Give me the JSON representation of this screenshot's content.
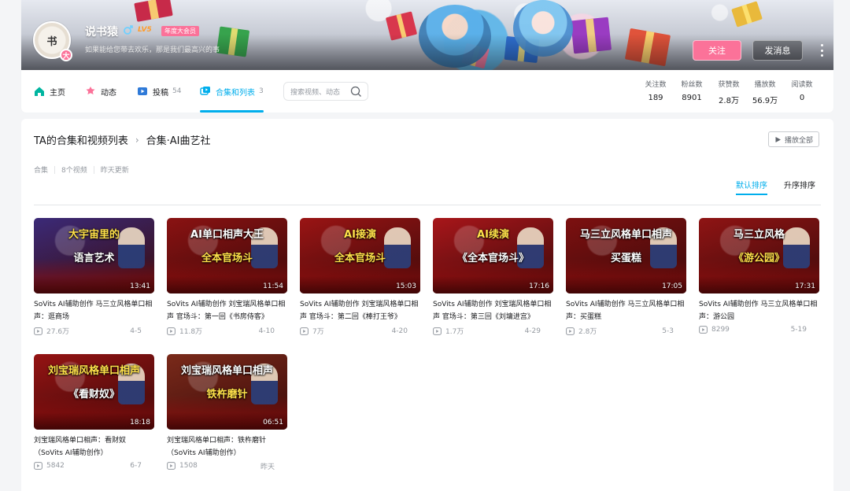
{
  "header": {
    "username": "说书猿",
    "level": "LV5",
    "vip_label": "年度大会员",
    "sign": "如果能给您带去欢乐，那是我们最高兴的事",
    "avatar_text": "书",
    "avatar_badge": "大",
    "follow_label": "关注",
    "message_label": "发消息"
  },
  "nav": {
    "items": [
      {
        "label": "主页",
        "count": ""
      },
      {
        "label": "动态",
        "count": ""
      },
      {
        "label": "投稿",
        "count": "54"
      },
      {
        "label": "合集和列表",
        "count": "3"
      }
    ],
    "search_placeholder": "搜索视频、动态"
  },
  "stats": [
    {
      "label": "关注数",
      "value": "189"
    },
    {
      "label": "粉丝数",
      "value": "8901"
    },
    {
      "label": "获赞数",
      "value": "2.8万"
    },
    {
      "label": "播放数",
      "value": "56.9万"
    },
    {
      "label": "阅读数",
      "value": "0"
    }
  ],
  "collection": {
    "breadcrumb_parent": "TA的合集和视频列表",
    "breadcrumb_current": "合集·AI曲艺社",
    "play_all_label": "播放全部",
    "meta_type": "合集",
    "meta_count": "8个视频",
    "meta_updated": "昨天更新",
    "sort_default": "默认排序",
    "sort_asc": "升序排序"
  },
  "videos": [
    {
      "title": "SoVits AI辅助创作 马三立风格单口相声：逛商场",
      "duration": "13:41",
      "views": "27.6万",
      "date": "4-5",
      "thumb_line1": "大宇宙里的",
      "thumb_line2": "语言艺术",
      "color": "#3b2a78"
    },
    {
      "title": "SoVits AI辅助创作 刘宝瑞风格单口相声 官场斗：第一回《书房侍客》",
      "duration": "11:54",
      "views": "11.8万",
      "date": "4-10",
      "thumb_line1": "AI单口相声大王",
      "thumb_line2": "全本官场斗",
      "color": "#8a1212"
    },
    {
      "title": "SoVits AI辅助创作 刘宝瑞风格单口相声 官场斗：第二回《棒打王爷》",
      "duration": "15:03",
      "views": "7万",
      "date": "4-20",
      "thumb_line1": "AI接演",
      "thumb_line2": "全本官场斗",
      "color": "#9a1414"
    },
    {
      "title": "SoVits AI辅助创作 刘宝瑞风格单口相声 官场斗：第三回《刘墉进宫》",
      "duration": "17:16",
      "views": "1.7万",
      "date": "4-29",
      "thumb_line1": "AI续演",
      "thumb_line2": "《全本官场斗》",
      "color": "#a8161a"
    },
    {
      "title": "SoVits AI辅助创作 马三立风格单口相声：买蛋糕",
      "duration": "17:05",
      "views": "2.8万",
      "date": "5-3",
      "thumb_line1": "马三立风格单口相声",
      "thumb_line2": "买蛋糕",
      "color": "#7d1010"
    },
    {
      "title": "SoVits AI辅助创作 马三立风格单口相声：游公园",
      "duration": "17:31",
      "views": "8299",
      "date": "5-19",
      "thumb_line1": "马三立风格",
      "thumb_line2": "《游公园》",
      "color": "#8f1414"
    },
    {
      "title": "刘宝瑞风格单口相声：看财奴（SoVits AI辅助创作）",
      "duration": "18:18",
      "views": "5842",
      "date": "6-7",
      "thumb_line1": "刘宝瑞风格单口相声",
      "thumb_line2": "《看财奴》",
      "color": "#951313"
    },
    {
      "title": "刘宝瑞风格单口相声：铁杵磨针（SoVits AI辅助创作）",
      "duration": "06:51",
      "views": "1508",
      "date": "昨天",
      "thumb_line1": "刘宝瑞风格单口相声",
      "thumb_line2": "铁杵磨针",
      "color": "#7a2a1a"
    }
  ]
}
